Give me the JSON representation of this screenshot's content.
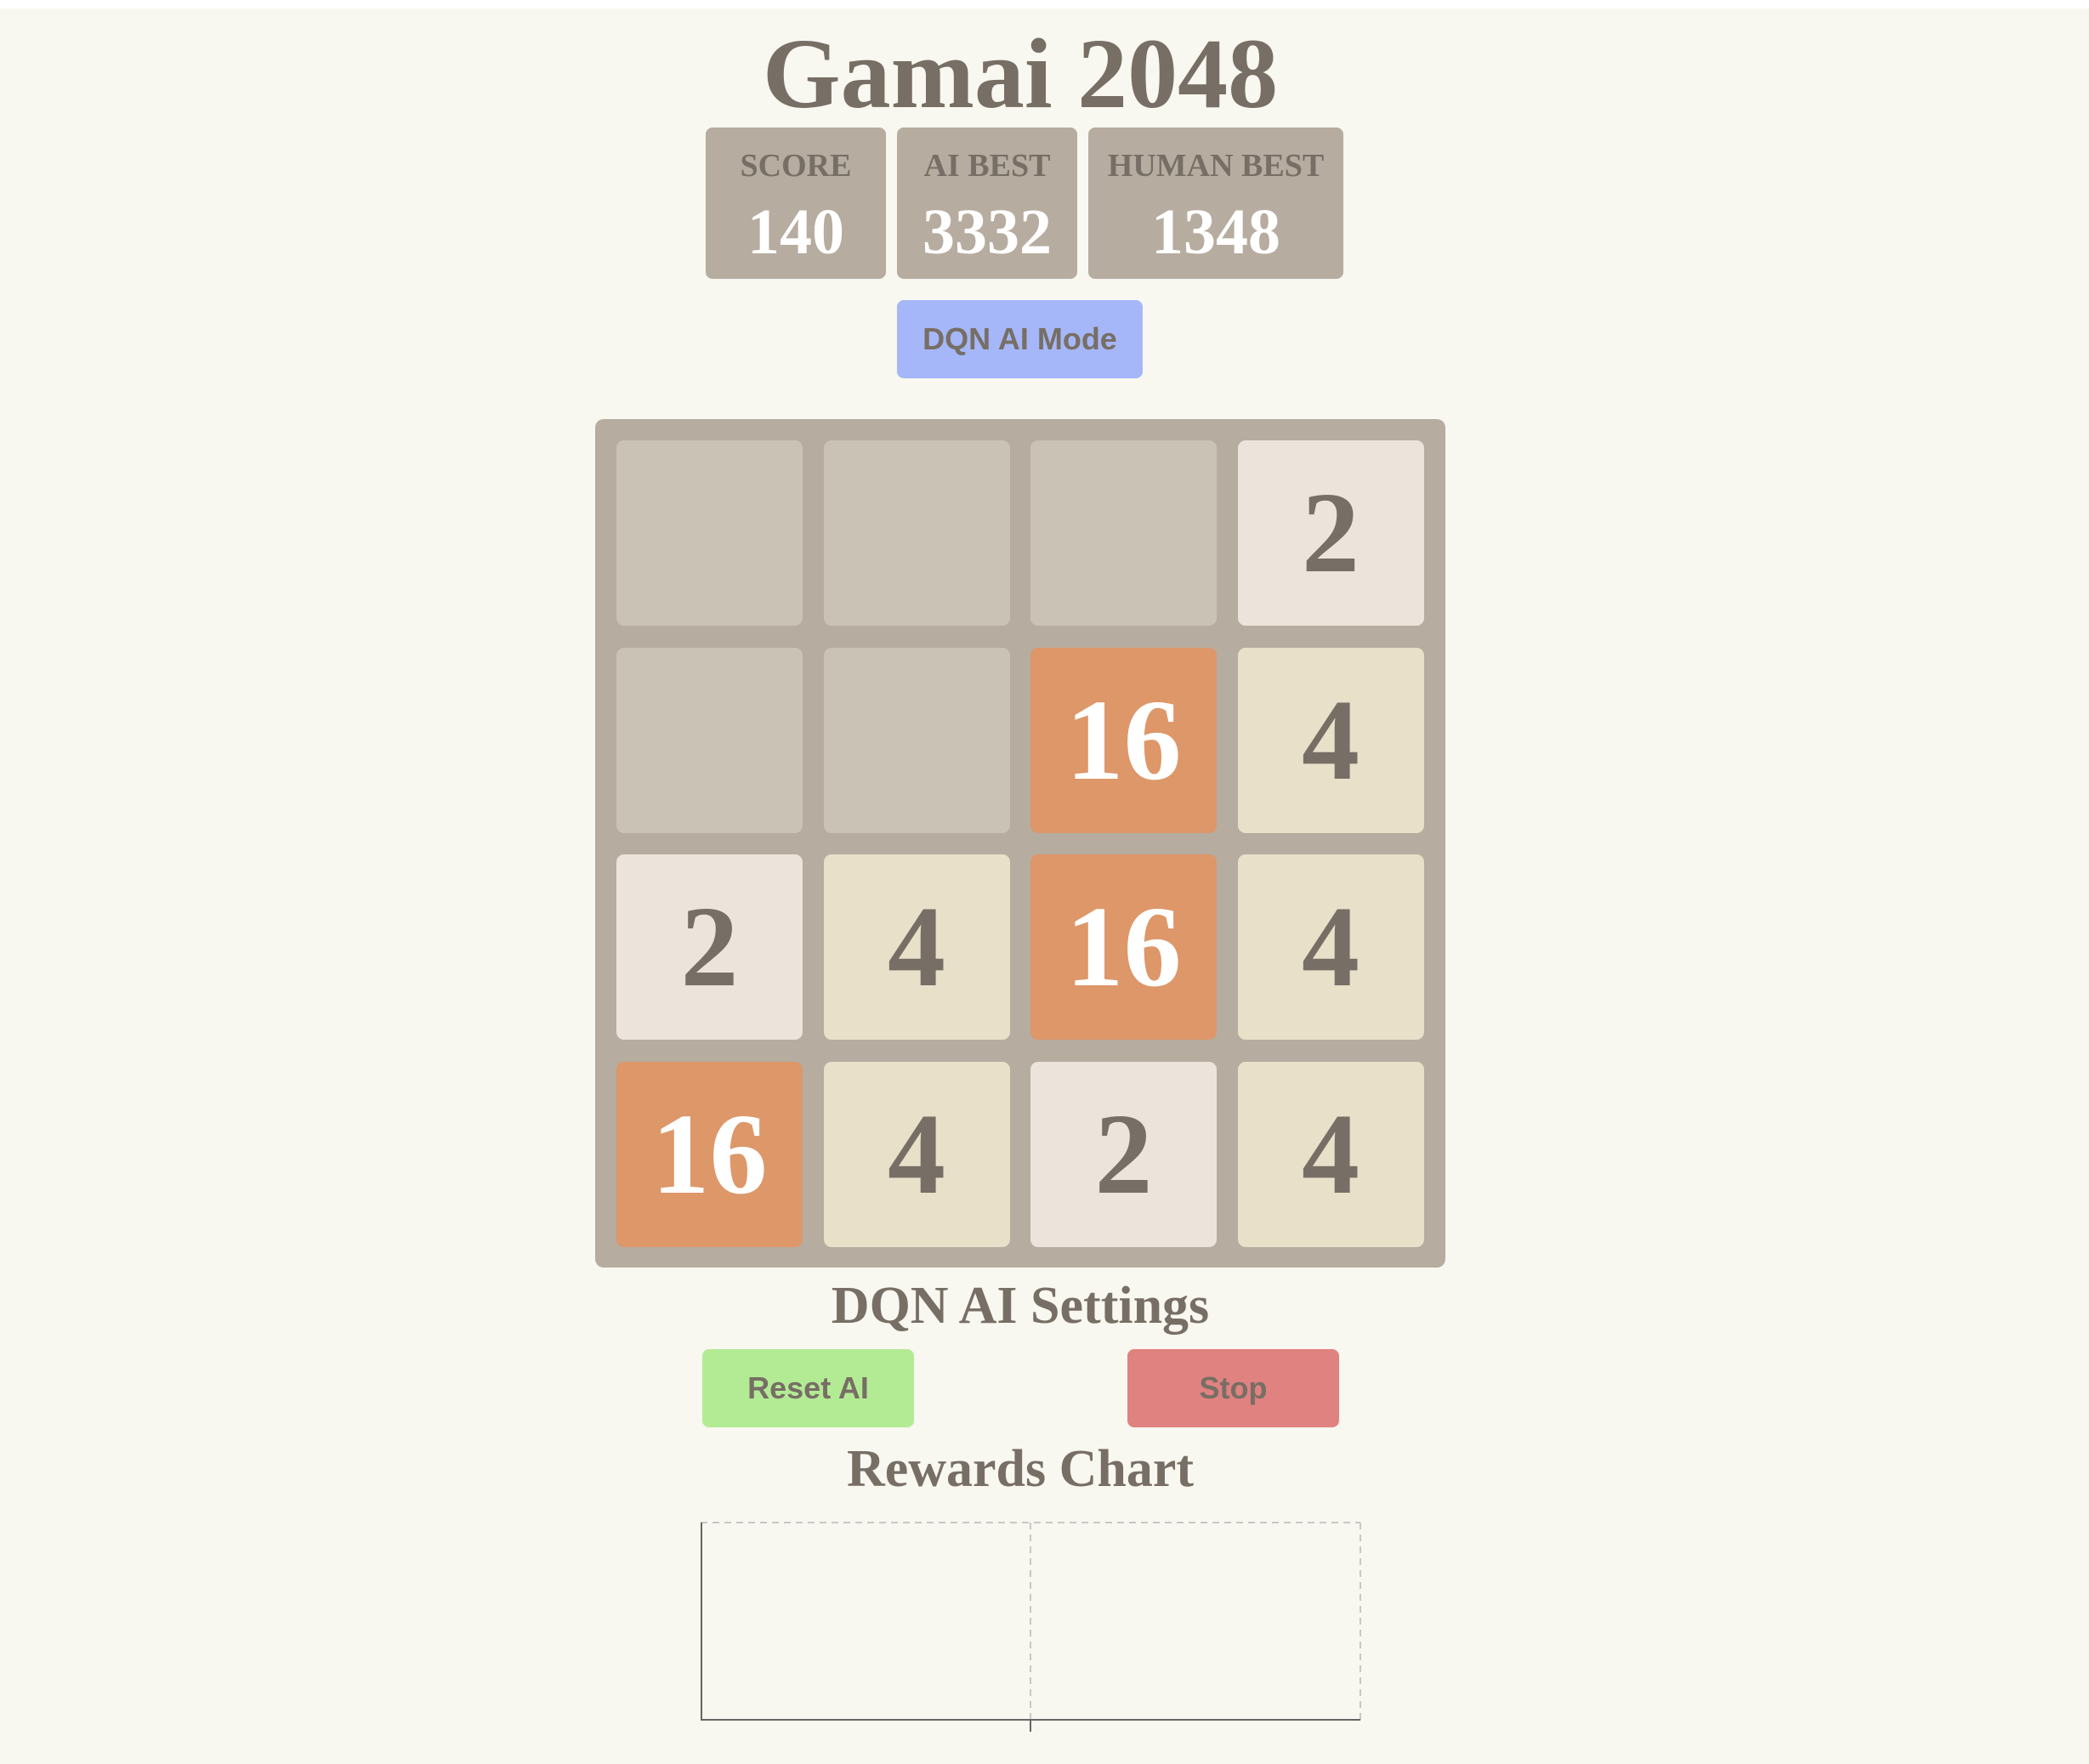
{
  "header": {
    "title": "Gamai 2048"
  },
  "scores": [
    {
      "label": "SCORE",
      "value": "140"
    },
    {
      "label": "AI BEST",
      "value": "3332"
    },
    {
      "label": "HUMAN BEST",
      "value": "1348"
    }
  ],
  "mode_button": {
    "label": "DQN AI Mode",
    "color": "#a5b7f8"
  },
  "board": {
    "rows": [
      [
        null,
        null,
        null,
        2
      ],
      [
        null,
        null,
        16,
        4
      ],
      [
        2,
        4,
        16,
        4
      ],
      [
        16,
        4,
        2,
        4
      ]
    ],
    "colors": {
      "empty": "#cac2b5",
      "2": "#ece4da",
      "4": "#e8e0c9",
      "16": "#dd9769",
      "background": "#b6ac9f"
    }
  },
  "settings": {
    "title": "DQN AI Settings",
    "reset_label": "Reset AI",
    "stop_label": "Stop",
    "reset_color": "#b3eb95",
    "stop_color": "#e08280"
  },
  "chart_section": {
    "title": "Rewards Chart"
  },
  "chart_data": {
    "type": "line",
    "title": "",
    "series": [],
    "grid": true
  }
}
